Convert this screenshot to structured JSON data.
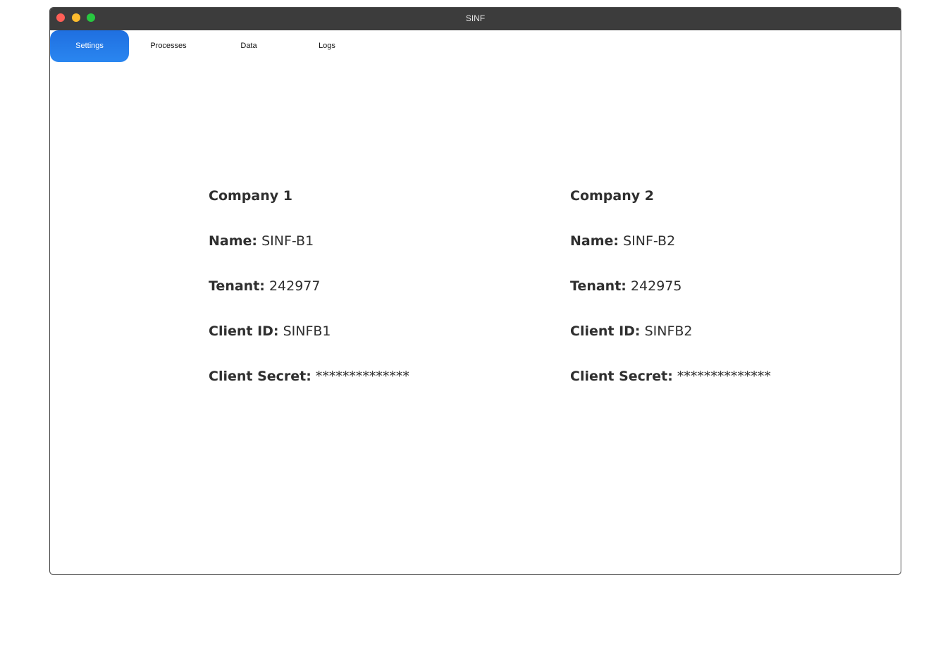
{
  "window": {
    "title": "SINF"
  },
  "tabs": [
    {
      "label": "Settings",
      "active": true
    },
    {
      "label": "Processes",
      "active": false
    },
    {
      "label": "Data",
      "active": false
    },
    {
      "label": "Logs",
      "active": false
    }
  ],
  "companies": [
    {
      "heading": "Company 1",
      "name_label": "Name:",
      "name": "SINF-B1",
      "tenant_label": "Tenant:",
      "tenant": "242977",
      "client_id_label": "Client ID:",
      "client_id": "SINFB1",
      "client_secret_label": "Client Secret:",
      "client_secret": "**************"
    },
    {
      "heading": "Company 2",
      "name_label": "Name:",
      "name": "SINF-B2",
      "tenant_label": "Tenant:",
      "tenant": "242975",
      "client_id_label": "Client ID:",
      "client_id": "SINFB2",
      "client_secret_label": "Client Secret:",
      "client_secret": "**************"
    }
  ],
  "colors": {
    "titlebar": "#3c3c3c",
    "active_tab": "#1f6fe0",
    "close": "#ff5f57",
    "minimize": "#febc2e",
    "maximize": "#28c840"
  }
}
